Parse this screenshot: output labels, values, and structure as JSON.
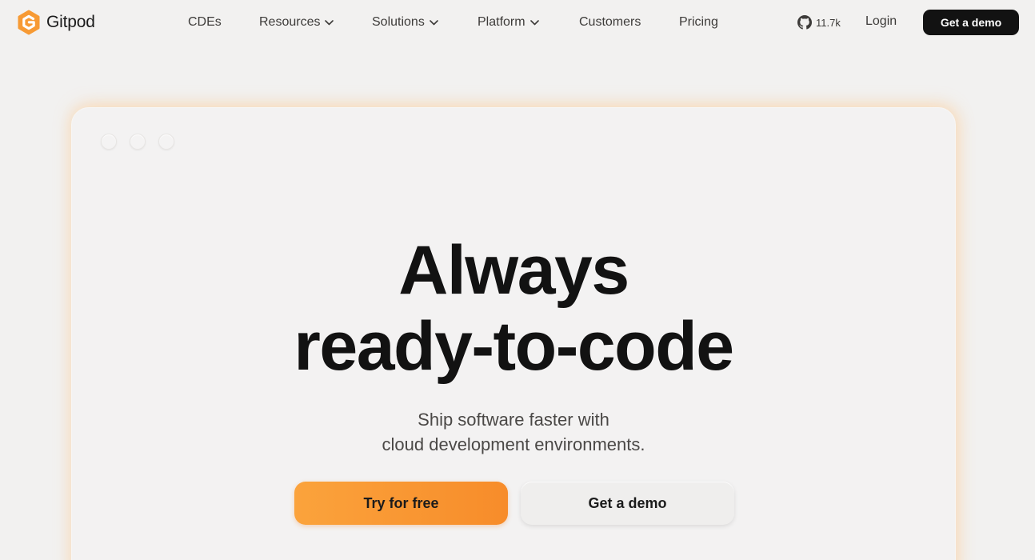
{
  "nav": {
    "brand": "Gitpod",
    "items": [
      {
        "label": "CDEs",
        "dropdown": false
      },
      {
        "label": "Resources",
        "dropdown": true
      },
      {
        "label": "Solutions",
        "dropdown": true
      },
      {
        "label": "Platform",
        "dropdown": true
      },
      {
        "label": "Customers",
        "dropdown": false
      },
      {
        "label": "Pricing",
        "dropdown": false
      }
    ],
    "github_stars": "11.7k",
    "login_label": "Login",
    "demo_label": "Get a demo"
  },
  "hero": {
    "headline_line1": "Always",
    "headline_line2": "ready-to-code",
    "subtitle_line1": "Ship software faster with",
    "subtitle_line2": "cloud development environments.",
    "primary_cta": "Try for free",
    "secondary_cta": "Get a demo"
  },
  "colors": {
    "background": "#f2f1f0",
    "brand_orange": "#fa9c36",
    "text_dark": "#121212",
    "button_dark": "#121212"
  },
  "icons": {
    "logo": "gitpod-logo-icon",
    "github": "github-icon",
    "chevron": "chevron-down-icon"
  }
}
